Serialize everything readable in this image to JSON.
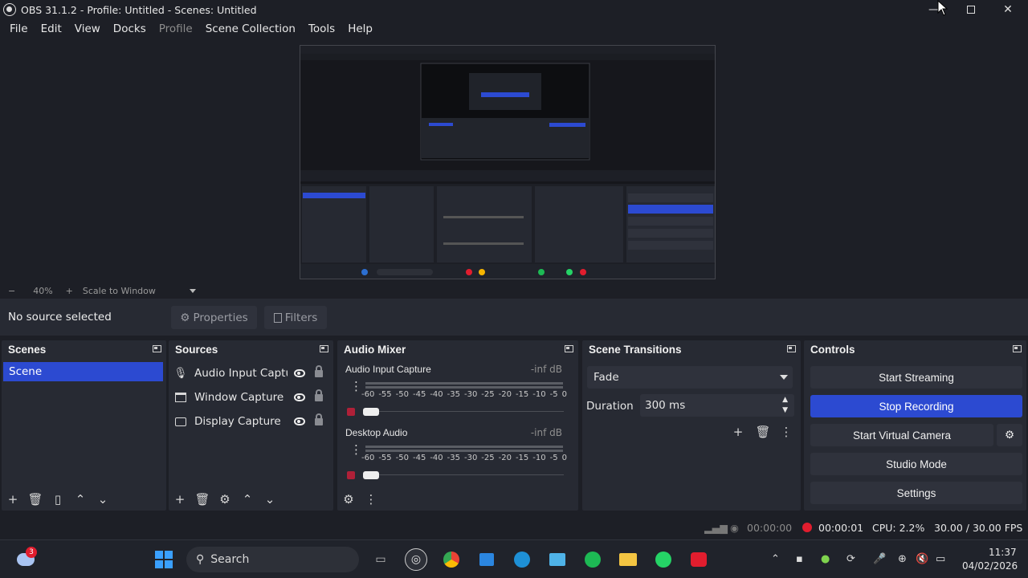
{
  "window": {
    "title": "OBS 31.1.2 - Profile: Untitled - Scenes: Untitled"
  },
  "menu": [
    "File",
    "Edit",
    "View",
    "Docks",
    "Profile",
    "Scene Collection",
    "Tools",
    "Help"
  ],
  "zoom": {
    "minus": "−",
    "value": "40%",
    "plus": "+",
    "mode": "Scale to Window"
  },
  "source_bar": {
    "status": "No source selected",
    "properties": "Properties",
    "filters": "Filters"
  },
  "scenes": {
    "title": "Scenes",
    "items": [
      "Scene"
    ]
  },
  "sources": {
    "title": "Sources",
    "items": [
      {
        "name": "Audio Input Captur",
        "icon": "mic-icon"
      },
      {
        "name": "Window Capture",
        "icon": "window-icon"
      },
      {
        "name": "Display Capture",
        "icon": "monitor-icon"
      }
    ]
  },
  "mixer": {
    "title": "Audio Mixer",
    "channels": [
      {
        "name": "Audio Input Capture",
        "level": "-inf dB"
      },
      {
        "name": "Desktop Audio",
        "level": "-inf dB"
      }
    ],
    "ticks": [
      "-60",
      "-55",
      "-50",
      "-45",
      "-40",
      "-35",
      "-30",
      "-25",
      "-20",
      "-15",
      "-10",
      "-5",
      "0"
    ]
  },
  "transitions": {
    "title": "Scene Transitions",
    "selected": "Fade",
    "duration_label": "Duration",
    "duration_value": "300 ms"
  },
  "controls": {
    "title": "Controls",
    "start_streaming": "Start Streaming",
    "stop_recording": "Stop Recording",
    "start_virtual_camera": "Start Virtual Camera",
    "studio_mode": "Studio Mode",
    "settings": "Settings"
  },
  "status": {
    "stream_time": "00:00:00",
    "rec_time": "00:00:01",
    "cpu": "CPU: 2.2%",
    "fps": "30.00 / 30.00 FPS"
  },
  "taskbar": {
    "search": "Search",
    "time": "11:37",
    "date": "04/02/2026",
    "badge": "3"
  },
  "colors": {
    "accent": "#2c4ad1",
    "record": "#e11d2e",
    "panel": "#272a33",
    "bg": "#1d1f26"
  }
}
